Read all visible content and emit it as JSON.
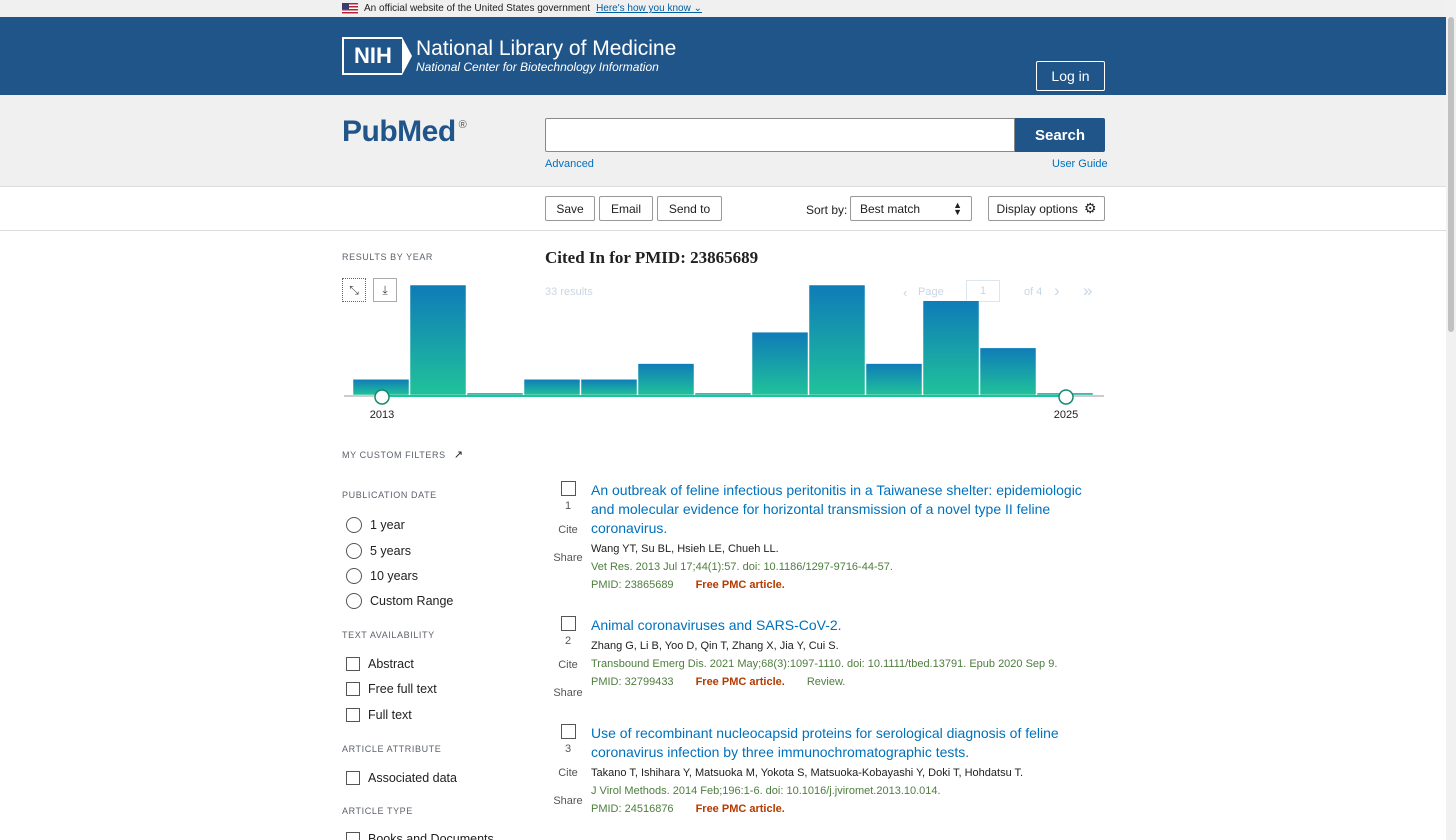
{
  "gov_banner": {
    "text": "An official website of the United States government",
    "link": "Here's how you know"
  },
  "nih": {
    "box": "NIH",
    "title": "National Library of Medicine",
    "subtitle": "National Center for Biotechnology Information",
    "login": "Log in"
  },
  "search": {
    "logo": "PubMed",
    "logo_reg": "®",
    "button": "Search",
    "advanced": "Advanced",
    "user_guide": "User Guide",
    "value": ""
  },
  "toolbar": {
    "save": "Save",
    "email": "Email",
    "send_to": "Send to",
    "sort_label": "Sort by:",
    "sort_value": "Best match",
    "display_options": "Display options"
  },
  "sidebar": {
    "results_by_year": "RESULTS BY YEAR",
    "custom_filters": "MY CUSTOM FILTERS",
    "publication_date": {
      "label": "PUBLICATION DATE",
      "options": [
        "1 year",
        "5 years",
        "10 years",
        "Custom Range"
      ]
    },
    "text_availability": {
      "label": "TEXT AVAILABILITY",
      "options": [
        "Abstract",
        "Free full text",
        "Full text"
      ]
    },
    "article_attribute": {
      "label": "ARTICLE ATTRIBUTE",
      "options": [
        "Associated data"
      ]
    },
    "article_type": {
      "label": "ARTICLE TYPE",
      "options": [
        "Books and Documents"
      ]
    }
  },
  "chart_data": {
    "type": "bar",
    "categories": [
      "2013",
      "2014",
      "2015",
      "2016",
      "2017",
      "2018",
      "2019",
      "2020",
      "2021",
      "2022",
      "2023",
      "2024",
      "2025"
    ],
    "values": [
      1,
      7,
      0,
      1,
      1,
      2,
      0,
      4,
      7,
      2,
      6,
      3,
      0
    ],
    "start_label": "2013",
    "end_label": "2025",
    "colors": {
      "top": "#0f7bb8",
      "bottom": "#20c29a"
    }
  },
  "results": {
    "title": "Cited In for PMID: 23865689",
    "count_faint": "33 results",
    "page_label": "Page",
    "page_value": "1",
    "page_of": "of 4",
    "items": [
      {
        "num": "1",
        "cite": "Cite",
        "share": "Share",
        "title": "An outbreak of feline infectious peritonitis in a Taiwanese shelter: epidemiologic and molecular evidence for horizontal transmission of a novel type II feline coronavirus.",
        "authors": "Wang YT, Su BL, Hsieh LE, Chueh LL.",
        "journal": "Vet Res. 2013 Jul 17;44(1):57. doi: 10.1186/1297-9716-44-57.",
        "pmid": "PMID: 23865689",
        "free": "Free PMC article.",
        "review": ""
      },
      {
        "num": "2",
        "cite": "Cite",
        "share": "Share",
        "title": "Animal coronaviruses and SARS-CoV-2.",
        "authors": "Zhang G, Li B, Yoo D, Qin T, Zhang X, Jia Y, Cui S.",
        "journal": "Transbound Emerg Dis. 2021 May;68(3):1097-1110. doi: 10.1111/tbed.13791. Epub 2020 Sep 9.",
        "pmid": "PMID: 32799433",
        "free": "Free PMC article.",
        "review": "Review."
      },
      {
        "num": "3",
        "cite": "Cite",
        "share": "Share",
        "title": "Use of recombinant nucleocapsid proteins for serological diagnosis of feline coronavirus infection by three immunochromatographic tests.",
        "authors": "Takano T, Ishihara Y, Matsuoka M, Yokota S, Matsuoka-Kobayashi Y, Doki T, Hohdatsu T.",
        "journal": "J Virol Methods. 2014 Feb;196:1-6. doi: 10.1016/j.jviromet.2013.10.014.",
        "pmid": "PMID: 24516876",
        "free": "Free PMC article.",
        "review": ""
      }
    ]
  }
}
